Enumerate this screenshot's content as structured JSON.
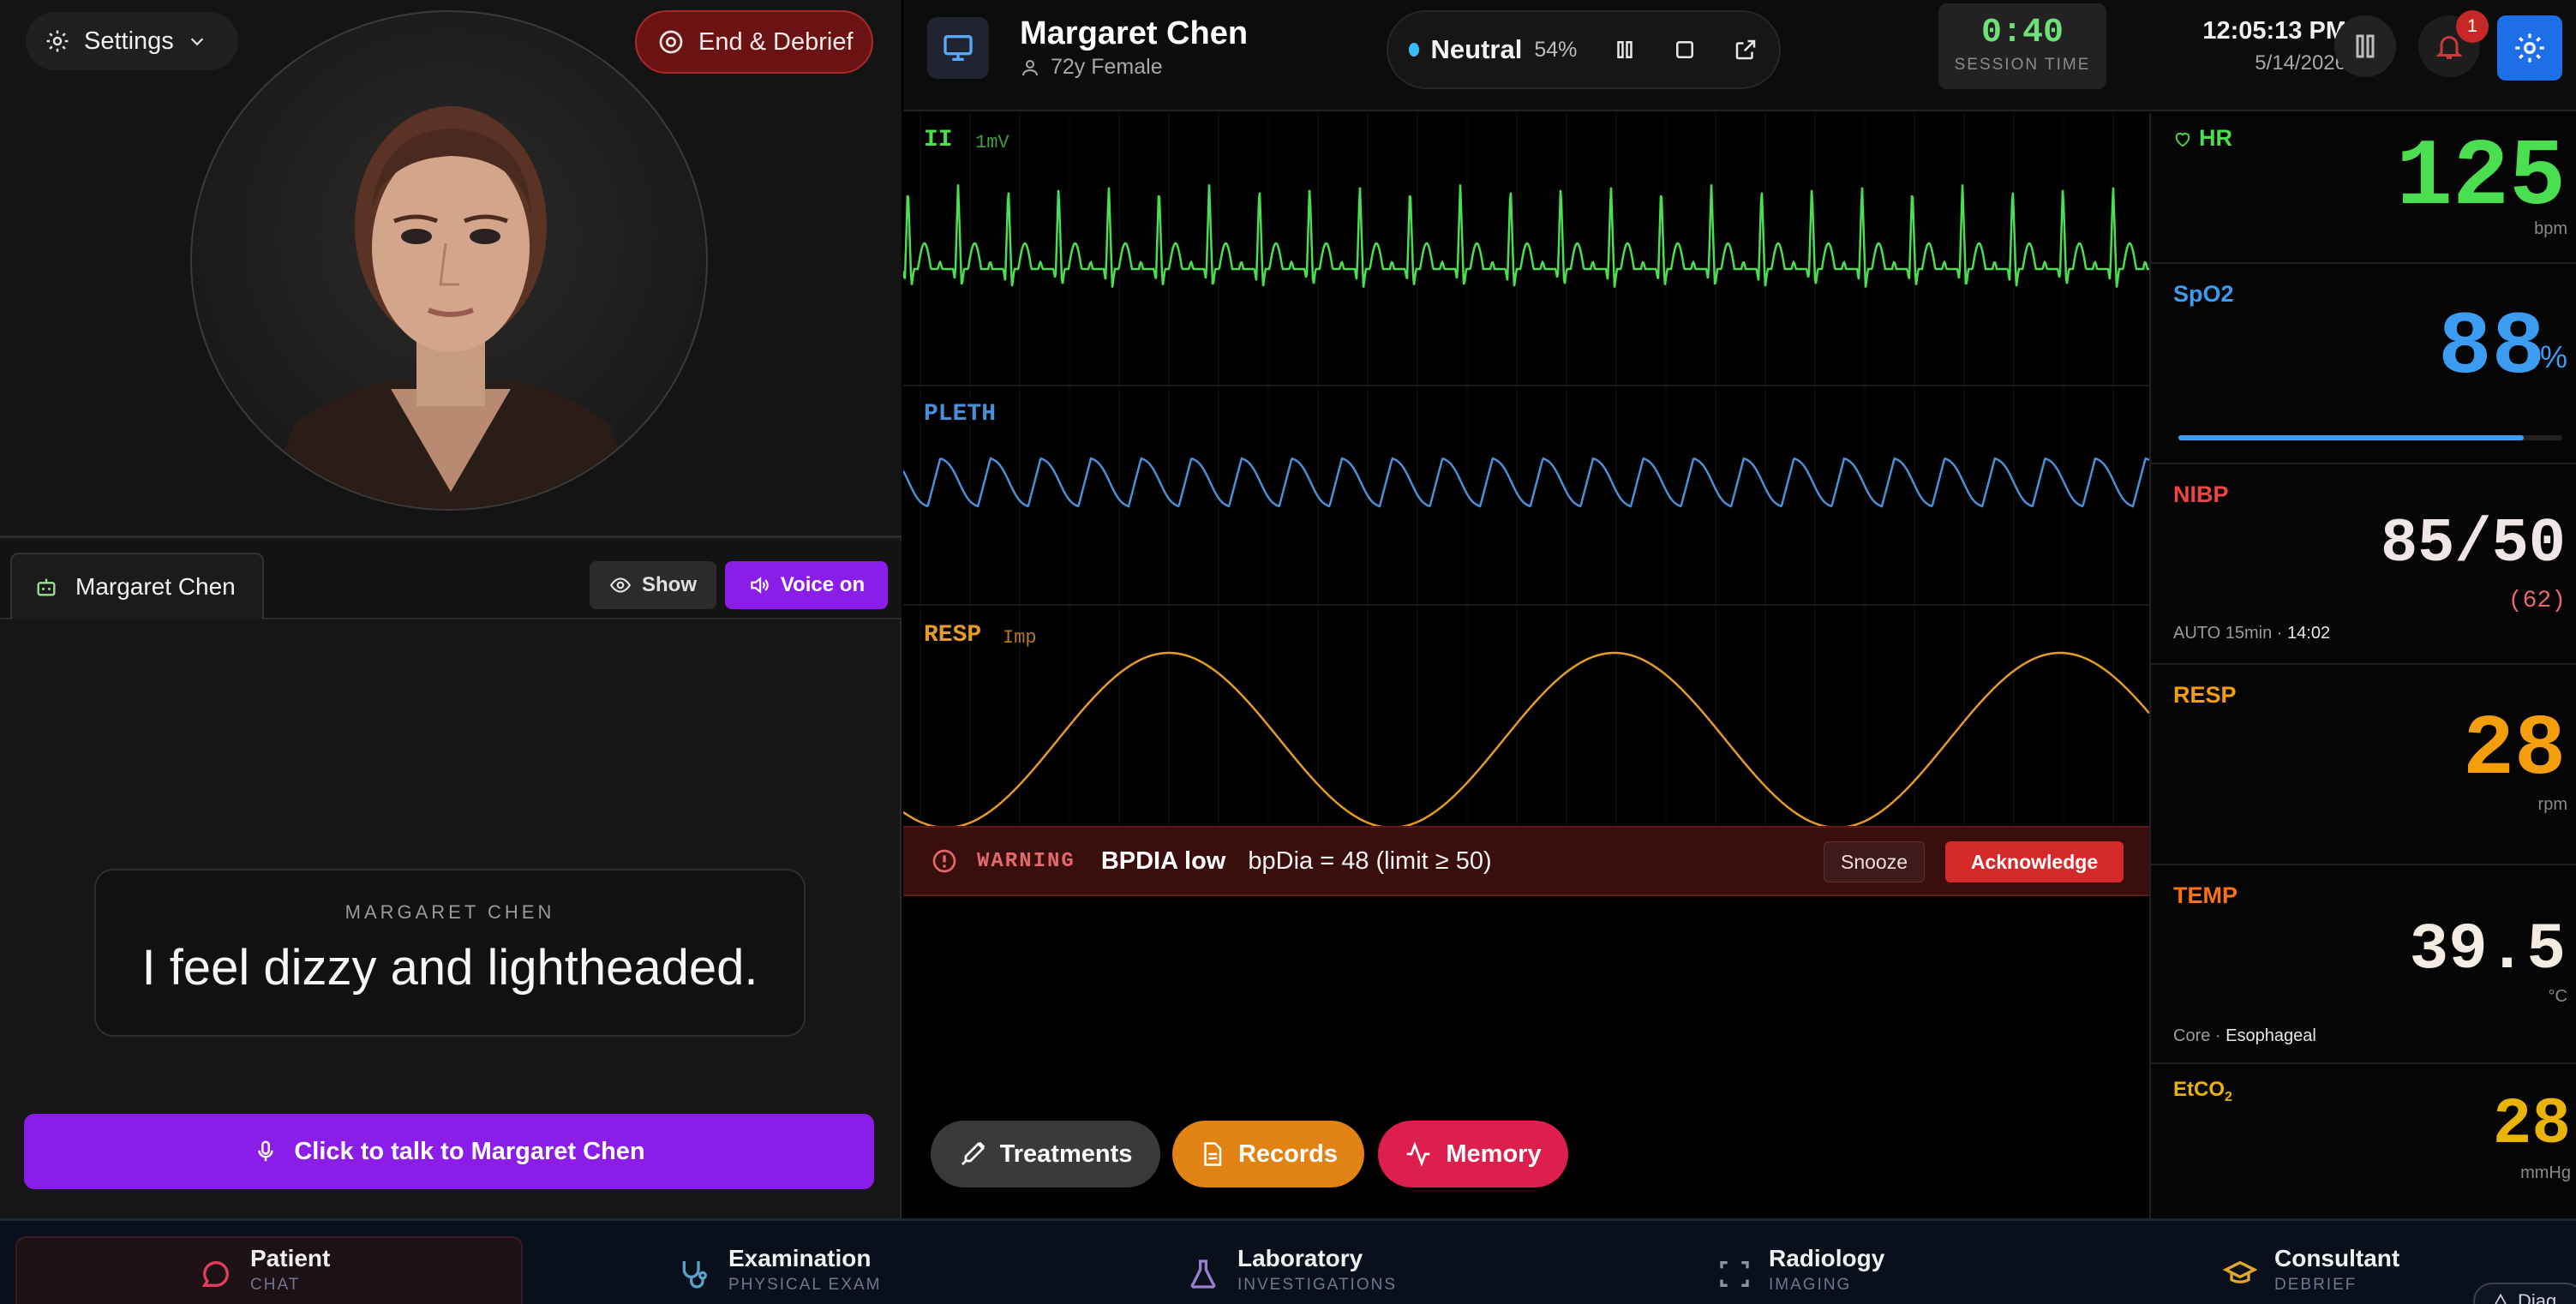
{
  "left_panel": {
    "settings_label": "Settings",
    "end_debrief_label": "End & Debrief",
    "chat_tab_label": "Margaret Chen",
    "show_label": "Show",
    "voice_label": "Voice on",
    "speech_speaker": "MARGARET CHEN",
    "speech_text": "I feel dizzy and lightheaded.",
    "talk_button_label": "Click to talk to Margaret Chen"
  },
  "header": {
    "patient_name": "Margaret Chen",
    "patient_details": "72y Female",
    "emotion_label": "Neutral",
    "emotion_percent": "54%",
    "session_time": "0:40",
    "session_time_label": "SESSION TIME",
    "clock_time": "12:05:13 PM",
    "clock_date": "5/14/2026",
    "notification_count": "1"
  },
  "waveforms": {
    "ecg_label": "II",
    "ecg_scale": "1mV",
    "pleth_label": "PLETH",
    "resp_label": "RESP",
    "resp_sub": "Imp",
    "colors": {
      "ecg": "#4ade50",
      "pleth": "#4a90d9",
      "resp": "#e59a2a"
    }
  },
  "alarm": {
    "level": "WARNING",
    "name": "BPDIA low",
    "detail": "bpDia = 48 (limit ≥ 50)",
    "snooze_label": "Snooze",
    "ack_label": "Acknowledge"
  },
  "tools": {
    "treatments_label": "Treatments",
    "records_label": "Records",
    "memory_label": "Memory"
  },
  "vitals": {
    "hr": {
      "label": "HR",
      "value": "125",
      "unit": "bpm",
      "color": "#4ade50"
    },
    "spo2": {
      "label": "SpO2",
      "value": "88",
      "unit": "%",
      "color": "#3b9cf2",
      "level": 0.9
    },
    "nibp": {
      "label": "NIBP",
      "value": "85/50",
      "mean": "(62)",
      "note_prefix": "AUTO 15min ·",
      "note_time": "14:02",
      "color": "#ef4444"
    },
    "resp": {
      "label": "RESP",
      "value": "28",
      "unit": "rpm",
      "color": "#f59e0b"
    },
    "temp": {
      "label": "TEMP",
      "value": "39.5",
      "unit": "°C",
      "note_prefix": "Core ·",
      "note_site": "Esophageal",
      "color": "#f97316"
    },
    "etco2": {
      "label": "EtCO",
      "label_sub": "2",
      "value": "28",
      "unit": "mmHg",
      "color": "#eab308"
    }
  },
  "bottom_nav": {
    "items": [
      {
        "title": "Patient",
        "sub": "CHAT"
      },
      {
        "title": "Examination",
        "sub": "PHYSICAL EXAM"
      },
      {
        "title": "Laboratory",
        "sub": "INVESTIGATIONS"
      },
      {
        "title": "Radiology",
        "sub": "IMAGING"
      },
      {
        "title": "Consultant",
        "sub": "DEBRIEF"
      }
    ],
    "diag_label": "Diag"
  }
}
